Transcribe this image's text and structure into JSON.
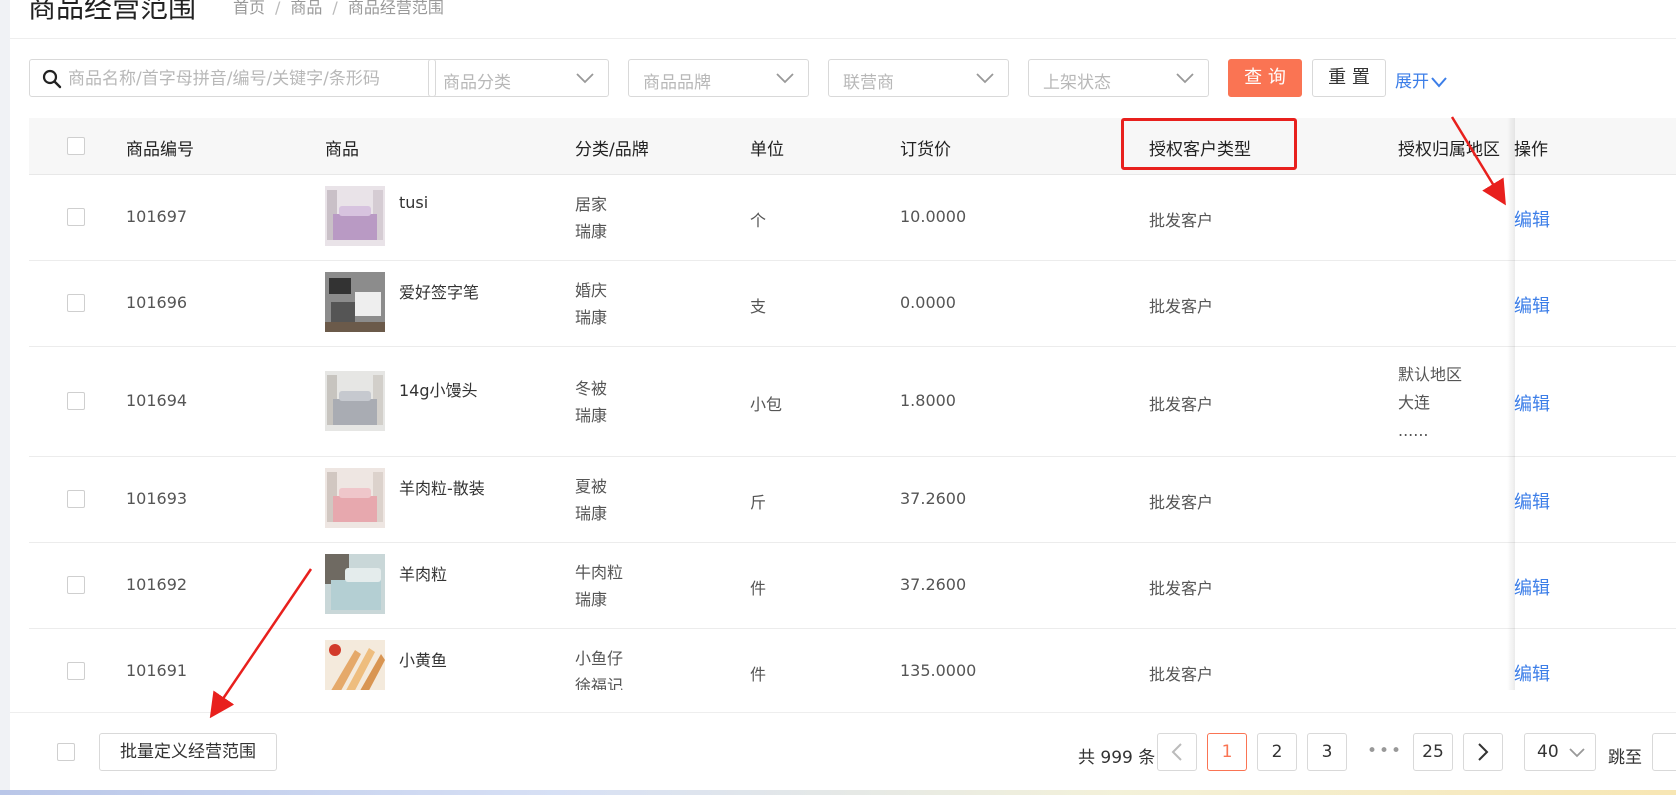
{
  "header": {
    "title": "商品经营范围",
    "breadcrumb": [
      "首页",
      "商品",
      "商品经营范围"
    ]
  },
  "filters": {
    "search_placeholder": "商品名称/首字母拼音/编号/关键字/条形码",
    "category_placeholder": "商品分类",
    "brand_placeholder": "商品品牌",
    "partner_placeholder": "联营商",
    "status_placeholder": "上架状态",
    "query_label": "查 询",
    "reset_label": "重 置",
    "expand_label": "展开"
  },
  "table": {
    "columns": {
      "code": "商品编号",
      "product": "商品",
      "category": "分类/品牌",
      "unit": "单位",
      "price": "订货价",
      "customer_type": "授权客户类型",
      "region": "授权归属地区",
      "action": "操作"
    },
    "rows": [
      {
        "code": "101697",
        "name": "tusi",
        "category": "居家",
        "brand": "瑞康",
        "unit": "个",
        "price": "10.0000",
        "customer_type": "批发客户",
        "region": [
          "",
          "",
          ""
        ],
        "action": "编辑"
      },
      {
        "code": "101696",
        "name": "爱好签字笔",
        "category": "婚庆",
        "brand": "瑞康",
        "unit": "支",
        "price": "0.0000",
        "customer_type": "批发客户",
        "region": [
          "",
          "",
          ""
        ],
        "action": "编辑"
      },
      {
        "code": "101694",
        "name": "14g小馒头",
        "category": "冬被",
        "brand": "瑞康",
        "unit": "小包",
        "price": "1.8000",
        "customer_type": "批发客户",
        "region": [
          "默认地区",
          "大连",
          "......"
        ],
        "action": "编辑"
      },
      {
        "code": "101693",
        "name": "羊肉粒-散装",
        "category": "夏被",
        "brand": "瑞康",
        "unit": "斤",
        "price": "37.2600",
        "customer_type": "批发客户",
        "region": [
          "",
          "",
          ""
        ],
        "action": "编辑"
      },
      {
        "code": "101692",
        "name": "羊肉粒",
        "category": "牛肉粒",
        "brand": "瑞康",
        "unit": "件",
        "price": "37.2600",
        "customer_type": "批发客户",
        "region": [
          "",
          "",
          ""
        ],
        "action": "编辑"
      },
      {
        "code": "101691",
        "name": "小黄鱼",
        "category": "小鱼仔",
        "brand": "徐福记",
        "unit": "件",
        "price": "135.0000",
        "customer_type": "批发客户",
        "region": [
          "",
          "",
          ""
        ],
        "action": "编辑"
      }
    ]
  },
  "footer": {
    "batch_label": "批量定义经营范围",
    "total_text": "共 999 条",
    "pages": [
      "1",
      "2",
      "3",
      "25"
    ],
    "ellipsis": "•••",
    "current_page": "1",
    "page_size": "40",
    "jump_label": "跳至"
  },
  "colors": {
    "accent": "#fa7453",
    "link": "#3c7ee8",
    "highlight": "#e8201d"
  }
}
